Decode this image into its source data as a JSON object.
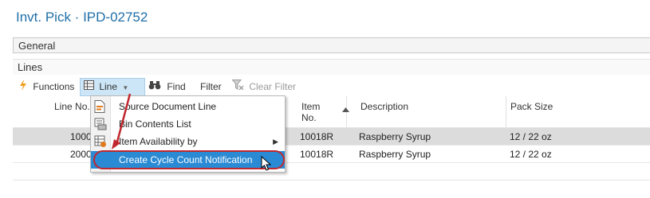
{
  "window": {
    "title": "Invt. Pick · IPD-02752"
  },
  "fasttabs": {
    "general": "General",
    "lines": "Lines"
  },
  "toolbar": {
    "functions": "Functions",
    "line": "Line",
    "find": "Find",
    "filter": "Filter",
    "clear_filter": "Clear Filter"
  },
  "table": {
    "headers": {
      "line_no": "Line No.",
      "item_no": "Item\nNo.",
      "description": "Description",
      "pack_size": "Pack Size"
    },
    "rows": [
      {
        "line_no": "10000",
        "item_no": "10018R",
        "description": "Raspberry Syrup",
        "pack_size": "12 / 22 oz"
      },
      {
        "line_no": "20000",
        "item_no": "10018R",
        "description": "Raspberry Syrup",
        "pack_size": "12 / 22 oz"
      }
    ]
  },
  "context_menu": {
    "items": [
      {
        "label": "Source Document Line",
        "icon": "document-icon"
      },
      {
        "label": "Bin Contents List",
        "icon": "bin-list-icon"
      },
      {
        "label": "Item Availability by",
        "icon": "availability-icon",
        "submenu": true
      },
      {
        "label": "Create Cycle Count Notification",
        "icon": "",
        "highlighted": true
      }
    ]
  },
  "colors": {
    "title": "#1f6fa8",
    "highlight": "#2a8ad3",
    "annotation_red": "#c0282e",
    "selected_row": "#dcdcdc"
  }
}
